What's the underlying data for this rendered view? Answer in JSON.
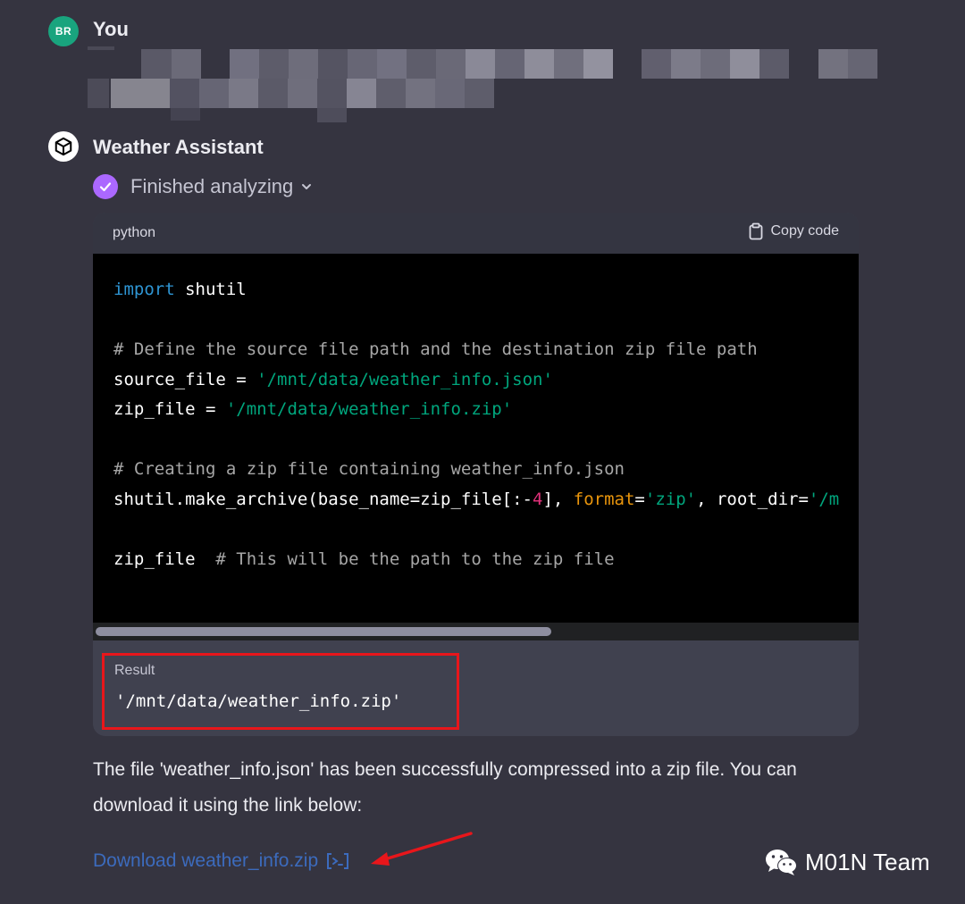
{
  "user_message": {
    "avatar_initials": "BR",
    "author": "You",
    "text_pixelated": true
  },
  "assistant": {
    "author": "Weather Assistant",
    "status": "Finished analyzing",
    "code_block": {
      "language": "python",
      "copy_label": "Copy code",
      "lines": [
        "import shutil",
        "",
        "# Define the source file path and the destination zip file path",
        "source_file = '/mnt/data/weather_info.json'",
        "zip_file = '/mnt/data/weather_info.zip'",
        "",
        "# Creating a zip file containing weather_info.json",
        "shutil.make_archive(base_name=zip_file[:-4], format='zip', root_dir='/m",
        "",
        "zip_file  # This will be the path to the zip file"
      ]
    },
    "result": {
      "label": "Result",
      "value": "'/mnt/data/weather_info.zip'"
    },
    "answer_text": "The file 'weather_info.json' has been successfully compressed into a zip file. You can download it using the link below:",
    "download_link": "Download weather_info.zip"
  },
  "watermark": "M01N Team",
  "colors": {
    "background": "#353440",
    "avatar_user": "#19a47e",
    "status_check": "#ab68ff",
    "keyword": "#2e95d3",
    "string": "#00a67d",
    "comment": "#a6a6a6",
    "number": "#df3079",
    "kwarg": "#e9950c",
    "highlight_box": "#e8161b",
    "link": "#3c6bbd"
  },
  "icons": [
    "wechat-icon",
    "copy-icon",
    "check-icon",
    "chevron-down-icon",
    "external-link-icon",
    "assistant-logo-icon"
  ]
}
